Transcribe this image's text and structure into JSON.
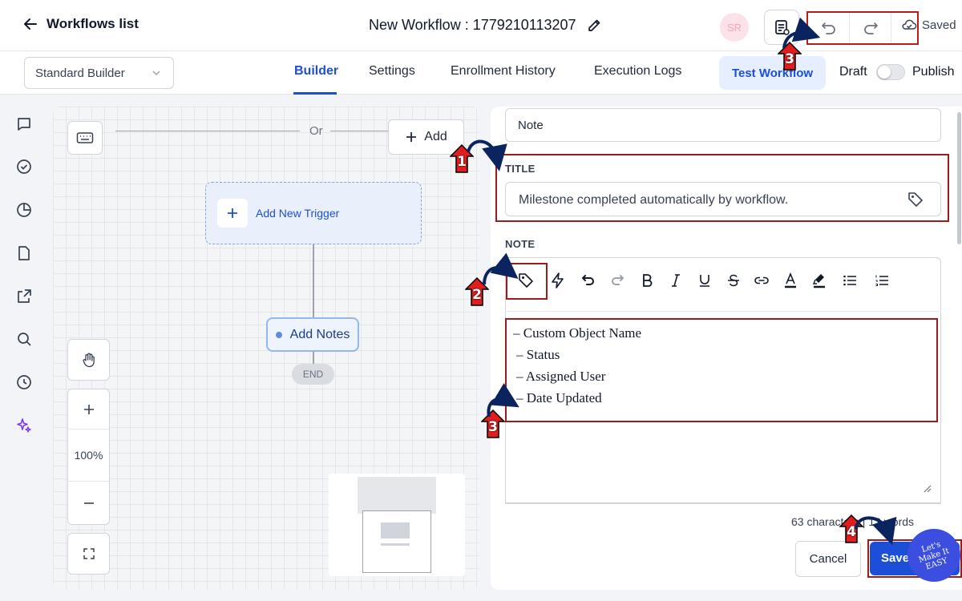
{
  "topbar": {
    "back_label": "Workflows list",
    "workflow_title": "New Workflow : 1779210113207",
    "avatar_initials": "SR",
    "saved_label": "Saved"
  },
  "subbar": {
    "builder_select": "Standard Builder",
    "tabs": [
      "Builder",
      "Settings",
      "Enrollment History",
      "Execution Logs"
    ],
    "active_tab": "Builder",
    "test_button": "Test Workflow",
    "draft_label": "Draft",
    "publish_label": "Publish"
  },
  "canvas": {
    "or_label": "Or",
    "add_label": "Add",
    "trigger_label": "Add New Trigger",
    "action_label": "Add Notes",
    "end_label": "END",
    "zoom": "100%"
  },
  "panel": {
    "note_select_value": "Note",
    "title_label": "TITLE",
    "title_value": "Milestone completed automatically by workflow.",
    "note_label": "NOTE",
    "note_lines": [
      "– Custom Object Name",
      "– Status",
      "– Assigned User",
      "– Date Updated"
    ],
    "counter": "63 characters | 12 words",
    "cancel_label": "Cancel",
    "save_label": "Save"
  },
  "annotations": {
    "badges": [
      "1",
      "2",
      "3",
      "3",
      "4"
    ],
    "logo_text": "Let's Make It EASY"
  },
  "colors": {
    "accent": "#1d4ed8",
    "annotation_red": "#9b1c1c",
    "badge_red": "#e11d1d",
    "arrow_navy": "#0b2460"
  }
}
